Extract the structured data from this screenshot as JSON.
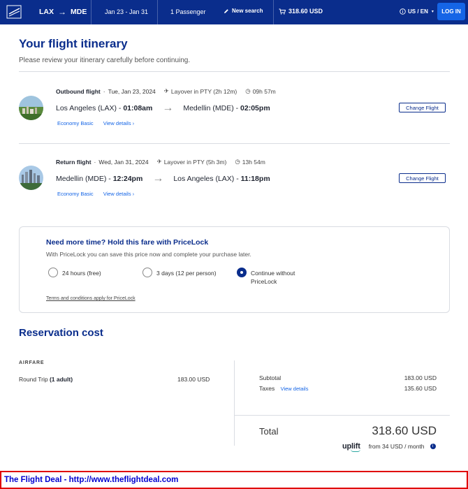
{
  "header": {
    "origin": "LAX",
    "destination": "MDE",
    "dates": "Jan 23 - Jan 31",
    "passengers": "1 Passenger",
    "new_search": "New search",
    "cart_total": "318.60 USD",
    "locale": "US / EN",
    "login": "LOG IN"
  },
  "page": {
    "title": "Your flight itinerary",
    "subtitle": "Please review your itinerary carefully before continuing."
  },
  "flights": [
    {
      "type": "Outbound flight",
      "date": "Tue, Jan 23, 2024",
      "layover": "Layover in PTY (2h 12m)",
      "duration": "09h 57m",
      "from_city": "Los Angeles (LAX)",
      "from_time": "01:08am",
      "to_city": "Medellin (MDE)",
      "to_time": "02:05pm",
      "fare": "Economy Basic",
      "details": "View details",
      "change": "Change Flight"
    },
    {
      "type": "Return flight",
      "date": "Wed, Jan 31, 2024",
      "layover": "Layover in PTY (5h 3m)",
      "duration": "13h 54m",
      "from_city": "Medellin (MDE)",
      "from_time": "12:24pm",
      "to_city": "Los Angeles (LAX)",
      "to_time": "11:18pm",
      "fare": "Economy Basic",
      "details": "View details",
      "change": "Change Flight"
    }
  ],
  "pricelock": {
    "title": "Need more time? Hold this fare with PriceLock",
    "description": "With PriceLock you can save this price now and complete your purchase later.",
    "options": [
      {
        "label": "24 hours (free)",
        "selected": false
      },
      {
        "label": "3 days (12 per person)",
        "selected": false
      },
      {
        "label": "Continue without PriceLock",
        "selected": true
      }
    ],
    "terms": "Terms and conditions apply for PriceLock"
  },
  "reservation": {
    "title": "Reservation cost",
    "airfare_label": "AIRFARE",
    "round_trip_label": "Round Trip",
    "round_trip_pax": "(1 adult)",
    "round_trip_value": "183.00 USD",
    "subtotal_label": "Subtotal",
    "subtotal_value": "183.00 USD",
    "taxes_label": "Taxes",
    "taxes_link": "View details",
    "taxes_value": "135.60 USD",
    "total_label": "Total",
    "total_value": "318.60 USD",
    "uplift_brand": "uplift",
    "uplift_text": "from 34 USD / month"
  },
  "banner": {
    "text": "The Flight Deal - http://www.theflightdeal.com"
  },
  "colors": {
    "brand_navy": "#0a2d8c",
    "link_blue": "#1565e6",
    "banner_red": "#e00000"
  }
}
